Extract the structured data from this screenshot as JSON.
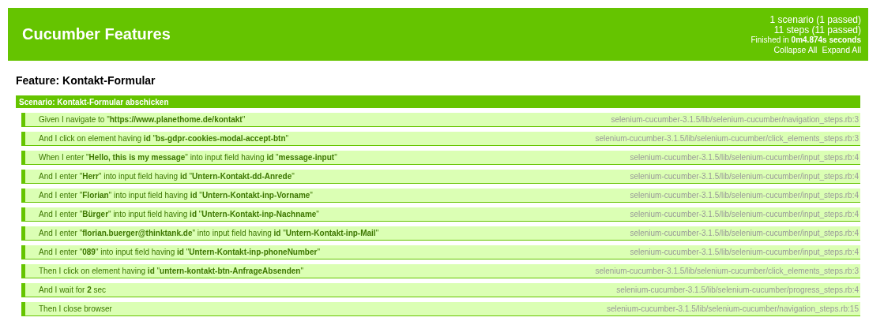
{
  "header": {
    "title": "Cucumber Features",
    "summary": [
      "1 scenario (1 passed)",
      "11 steps (11 passed)"
    ],
    "finished": "Finished in **0m4.874s seconds**",
    "links": [
      "Collapse All",
      "Expand All"
    ]
  },
  "feature": {
    "title": "Feature: Kontakt-Formular"
  },
  "scenario": {
    "title": "Scenario: Kontakt-Formular abschicken",
    "passed": true,
    "steps": [
      {
        "text": "Given I navigate to \"**https://www.planethome.de/kontakt**\"",
        "file": "selenium-cucumber-3.1.5/lib/selenium-cucumber/navigation_steps.rb:3",
        "passed": true
      },
      {
        "text": "And I click on element having **id** \"**bs-gdpr-cookies-modal-accept-btn**\"",
        "file": "selenium-cucumber-3.1.5/lib/selenium-cucumber/click_elements_steps.rb:3",
        "passed": true
      },
      {
        "text": "When I enter \"**Hello, this is my message**\" into input field having **id** \"**message-input**\"",
        "file": "selenium-cucumber-3.1.5/lib/selenium-cucumber/input_steps.rb:4",
        "passed": true
      },
      {
        "text": "And I enter \"**Herr**\" into input field having **id** \"**Untern-Kontakt-dd-Anrede**\"",
        "file": "selenium-cucumber-3.1.5/lib/selenium-cucumber/input_steps.rb:4",
        "passed": true
      },
      {
        "text": "And I enter \"**Florian**\" into input field having **id** \"**Untern-Kontakt-inp-Vorname**\"",
        "file": "selenium-cucumber-3.1.5/lib/selenium-cucumber/input_steps.rb:4",
        "passed": true
      },
      {
        "text": "And I enter \"**Bürger**\" into input field having **id** \"**Untern-Kontakt-inp-Nachname**\"",
        "file": "selenium-cucumber-3.1.5/lib/selenium-cucumber/input_steps.rb:4",
        "passed": true
      },
      {
        "text": "And I enter \"**florian.buerger@thinktank.de**\" into input field having **id** \"**Untern-Kontakt-inp-Mail**\"",
        "file": "selenium-cucumber-3.1.5/lib/selenium-cucumber/input_steps.rb:4",
        "passed": true
      },
      {
        "text": "And I enter \"**089**\" into input field having **id** \"**Untern-Kontakt-inp-phoneNumber**\"",
        "file": "selenium-cucumber-3.1.5/lib/selenium-cucumber/input_steps.rb:4",
        "passed": true
      },
      {
        "text": "Then I click on element having **id** \"**untern-kontakt-btn-AnfrageAbsenden**\"",
        "file": "selenium-cucumber-3.1.5/lib/selenium-cucumber/click_elements_steps.rb:3",
        "passed": true
      },
      {
        "text": "And I wait for **2** sec",
        "file": "selenium-cucumber-3.1.5/lib/selenium-cucumber/progress_steps.rb:4",
        "passed": true
      },
      {
        "text": "Then I close browser",
        "file": "selenium-cucumber-3.1.5/lib/selenium-cucumber/navigation_steps.rb:15",
        "passed": true
      }
    ]
  }
}
